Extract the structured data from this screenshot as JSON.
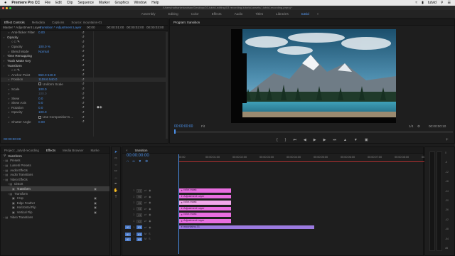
{
  "menubar": {
    "apple": "",
    "app": "Premiere Pro CC",
    "items": [
      "File",
      "Edit",
      "Clip",
      "Sequence",
      "Marker",
      "Graphics",
      "Window",
      "Help"
    ],
    "user": "tutvid"
  },
  "titlebar": {
    "path": "/Users/nathanielwadsan/Desktop/03-tutvid-editing/03 recording-tutorial-assets/_tutvid-recording.prproj *"
  },
  "workspaces": [
    "Assembly",
    "Editing",
    "Color",
    "Effects",
    "Audio",
    "Titles",
    "Libraries",
    "tutvid"
  ],
  "active_workspace": "tutvid",
  "effect_controls": {
    "tabs": [
      "Effect Controls",
      "Metadata",
      "Captions",
      "Source: mountains-01"
    ],
    "header_left": "Master * Adjustment Layer",
    "header_right": "transition * Adjustment Layer",
    "ruler": [
      "00:00",
      "00:00:01:00",
      "00:00:02:00",
      "00:00:03:00"
    ],
    "rows": [
      {
        "label": "Anti-flicker Filter",
        "value": "0.00",
        "indent": 1
      },
      {
        "label": "Opacity",
        "value": "",
        "indent": 0,
        "group": true
      },
      {
        "label": "",
        "value": "",
        "indent": 1,
        "shapes": true
      },
      {
        "label": "Opacity",
        "value": "100.0 %",
        "indent": 1
      },
      {
        "label": "Blend Mode",
        "value": "Normal",
        "indent": 1
      },
      {
        "label": "Time Remapping",
        "value": "",
        "indent": 0,
        "group": true
      },
      {
        "label": "Track Matte Key",
        "value": "",
        "indent": 0,
        "group": true
      },
      {
        "label": "Transform",
        "value": "",
        "indent": 0,
        "group": true
      },
      {
        "label": "",
        "value": "",
        "indent": 1,
        "shapes": true
      },
      {
        "label": "Anchor Point",
        "value": "960.0   540.0",
        "indent": 1
      },
      {
        "label": "Position",
        "value": "1108.6   540.0",
        "indent": 1,
        "highlight": true
      },
      {
        "label": "",
        "value": "Uniform Scale",
        "indent": 1,
        "checkbox": true
      },
      {
        "label": "Scale",
        "value": "100.0",
        "indent": 1
      },
      {
        "label": "",
        "value": "100.0",
        "indent": 1,
        "dim": true
      },
      {
        "label": "Skew",
        "value": "0.0",
        "indent": 1
      },
      {
        "label": "Skew Axis",
        "value": "0.0",
        "indent": 1
      },
      {
        "label": "Rotation",
        "value": "0.0",
        "indent": 1
      },
      {
        "label": "Opacity",
        "value": "100.0",
        "indent": 1
      },
      {
        "label": "",
        "value": "Use Composition's ...",
        "indent": 1,
        "checkbox": true
      },
      {
        "label": "Shutter Angle",
        "value": "0.00",
        "indent": 1
      }
    ],
    "timecode": "00:00:00:00"
  },
  "program": {
    "title": "Program: transition",
    "timecode_left": "00:00:00:00",
    "fit": "Fit",
    "ratio": "1/4",
    "timecode_right": "00:00:00:10"
  },
  "project": {
    "tabs": [
      "Project: _tutvid-recording",
      "Effects",
      "Media Browser",
      "Marke"
    ],
    "search": "transform",
    "tree": [
      {
        "label": "Presets",
        "indent": 0
      },
      {
        "label": "Lumetri Presets",
        "indent": 0
      },
      {
        "label": "Audio Effects",
        "indent": 0
      },
      {
        "label": "Audio Transitions",
        "indent": 0
      },
      {
        "label": "Video Effects",
        "indent": 0
      },
      {
        "label": "Distort",
        "indent": 1
      },
      {
        "label": "Transform",
        "indent": 2,
        "selected": true
      },
      {
        "label": "Transform",
        "indent": 1
      },
      {
        "label": "Crop",
        "indent": 2
      },
      {
        "label": "Edge Feather",
        "indent": 2
      },
      {
        "label": "Horizontal Flip",
        "indent": 2
      },
      {
        "label": "Vertical Flip",
        "indent": 2
      },
      {
        "label": "Video Transitions",
        "indent": 0
      }
    ]
  },
  "timeline": {
    "title": "transition",
    "timecode": "00:00:00:00",
    "ruler": [
      "00:00",
      "00:00:01:00",
      "00:00:02:00",
      "00:00:03:00",
      "00:00:04:00",
      "00:00:05:00",
      "00:00:06:00",
      "00:00:07:00",
      "00:00:08:00",
      "00:00:09:00"
    ],
    "tracks": [
      {
        "name": "V7",
        "clip": "color-mask",
        "color": "pink"
      },
      {
        "name": "V6",
        "clip": "Adjustment Layer",
        "color": "pink"
      },
      {
        "name": "V5",
        "clip": "color-mask",
        "color": "pale"
      },
      {
        "name": "V4",
        "clip": "Adjustment Layer",
        "color": "pink"
      },
      {
        "name": "V3",
        "clip": "color-mask",
        "color": "pink"
      },
      {
        "name": "V2",
        "clip": "Adjustment Layer",
        "color": "pink"
      },
      {
        "name": "V1",
        "clip": "mountains-01",
        "color": "purple"
      }
    ],
    "audio": [
      "A1",
      "A2"
    ],
    "src": "V1"
  },
  "meter": {
    "labels": [
      "0",
      "-6",
      "-12",
      "-18",
      "-24",
      "-30",
      "-36",
      "-42",
      "-48",
      "-54",
      "dB"
    ]
  }
}
